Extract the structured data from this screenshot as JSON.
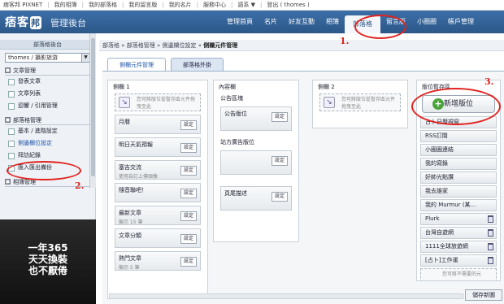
{
  "topbar": {
    "links": [
      "痞客邦 PIXNET",
      "我的相簿",
      "我的部落格",
      "我的留言版",
      "我的名片",
      "服務中心",
      "語系 ▼",
      "登出 ( thomes )"
    ],
    "sep": "|"
  },
  "header": {
    "logo": "痞客",
    "logo_badge": "邦",
    "admin_title": "管理後台",
    "nav": [
      "管理首頁",
      "名片",
      "好友互動",
      "相簿",
      "部落格",
      "留言版",
      "小圈圈",
      "帳戶管理"
    ]
  },
  "sidebar": {
    "head": "部落格後台",
    "select": "thomes / 攝影旅游",
    "arrow": "▼",
    "sections": [
      {
        "title": "文章管理",
        "box": "□",
        "items": [
          "發表文章",
          "文章列表",
          "迴響 / 引用管理"
        ]
      },
      {
        "title": "部落格管理",
        "box": "□",
        "items": [
          "基本 / 進階設定",
          "側邊欄位設定",
          "拜訪紀錄",
          "匯入匯出備份"
        ]
      },
      {
        "title": "相簿管理",
        "box": "□",
        "items": []
      }
    ],
    "banner": [
      "一年365",
      "天天換裝",
      "也不厭倦"
    ]
  },
  "main": {
    "breadcrumb": [
      "部落格",
      "部落格管理",
      "側邊欄位設定",
      "側欄元件管理"
    ],
    "crumb_sep": "»",
    "tabs": [
      "側欄元件管理",
      "部落格外掛"
    ],
    "columns": [
      {
        "title": "側欄 1",
        "drop_hint": "您可將版位從暫存區元件拖曳至此",
        "drop_icon": "↘",
        "widgets": [
          {
            "name": "月曆",
            "sub": ""
          },
          {
            "name": "明日天氣預報",
            "sub": ""
          },
          {
            "name": "塞吉交流",
            "sub": "使用自訂上傳頭像"
          },
          {
            "name": "隨音聯吧！",
            "sub": ""
          },
          {
            "name": "最新文章",
            "sub": "顯示 15 筆"
          },
          {
            "name": "文章分類",
            "sub": ""
          },
          {
            "name": "熱門文章",
            "sub": "顯示 5 筆"
          }
        ]
      },
      {
        "title": "內容欄",
        "sections": [
          {
            "label": "公告區塊",
            "widgets": [
              {
                "name": "公告版位",
                "sub": ""
              }
            ]
          },
          {
            "label": "站方廣告版位",
            "widgets": [
              {
                "name": "",
                "sub": ""
              }
            ]
          },
          {
            "label": "",
            "widgets": [
              {
                "name": "頁尾描述",
                "sub": ""
              }
            ]
          }
        ]
      },
      {
        "title": "側欄 2",
        "drop_hint": "您可將版位從暫存區元件拖曳至此",
        "drop_icon": "↘"
      }
    ],
    "set_label": "設定",
    "stock": {
      "title": "版位暫存區",
      "add_label": "新增版位",
      "add_icon": "+",
      "items": [
        "占卜日曆視窗",
        "RSS訂閱",
        "小圈圈連結",
        "我的寫錄",
        "好帥光點讚",
        "我去誰家",
        "我的 Murmur (某...",
        "Plurk",
        "台灣自遊網",
        "1111全球旅遊網",
        "[占卜]工作運"
      ],
      "drop_hint": "您可將不需要的元",
      "trash_flags": [
        false,
        false,
        false,
        false,
        false,
        false,
        false,
        true,
        true,
        true,
        true
      ]
    },
    "save_label": "儲存新圖"
  },
  "annotations": [
    "1.",
    "2.",
    "3."
  ]
}
